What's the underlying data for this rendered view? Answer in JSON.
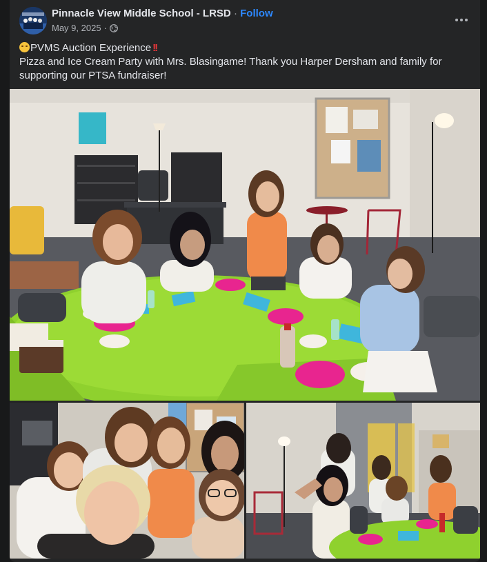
{
  "post": {
    "page_name": "Pinnacle View Middle School - LRSD",
    "separator": "·",
    "follow_label": "Follow",
    "date": "May 9, 2025",
    "audience_icon": "globe-icon",
    "more_icon": "more-options-icon",
    "caption": {
      "title": "PVMS Auction Experience",
      "body": "Pizza and Ice Cream Party with Mrs. Blasingame! Thank you Harper Dersham and family for supporting our PTSA fundraiser!"
    }
  },
  "photos": [
    {
      "name": "pizza-party-room-photo"
    },
    {
      "name": "selfie-group-photo"
    },
    {
      "name": "students-dancing-photo"
    }
  ],
  "colors": {
    "background": "#18191a",
    "card": "#242526",
    "text_primary": "#e4e6eb",
    "text_secondary": "#b0b3b8",
    "link": "#2d88ff",
    "tablecloth": "#8fd12e",
    "plates": "#e8258f"
  }
}
